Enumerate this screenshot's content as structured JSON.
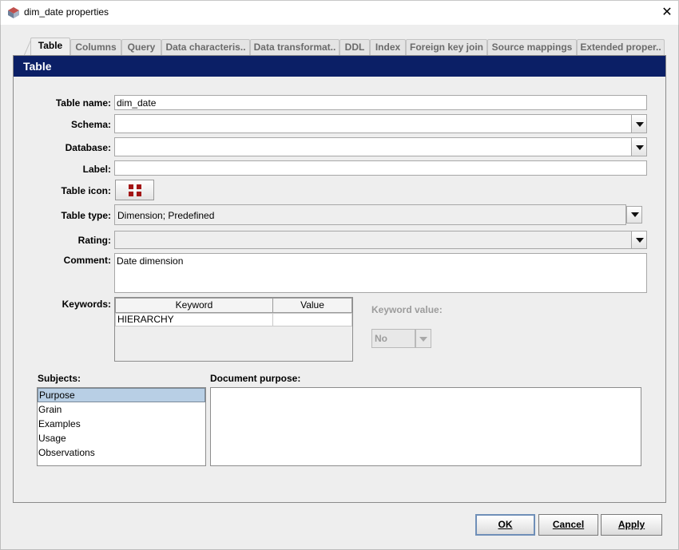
{
  "window": {
    "title": "dim_date properties",
    "app_icon": "app-logo-icon",
    "close_glyph": "✕"
  },
  "tabs": [
    {
      "label": "Table",
      "active": true
    },
    {
      "label": "Columns"
    },
    {
      "label": "Query"
    },
    {
      "label": "Data characteris.."
    },
    {
      "label": "Data transformat.."
    },
    {
      "label": "DDL"
    },
    {
      "label": "Index"
    },
    {
      "label": "Foreign key join"
    },
    {
      "label": "Source mappings"
    },
    {
      "label": "Extended proper.."
    }
  ],
  "panel": {
    "header": "Table"
  },
  "form": {
    "table_name": {
      "label": "Table name:",
      "value": "dim_date"
    },
    "schema": {
      "label": "Schema:",
      "value": ""
    },
    "database": {
      "label": "Database:",
      "value": ""
    },
    "label_field": {
      "label": "Label:",
      "value": ""
    },
    "table_icon": {
      "label": "Table icon:",
      "icon": "dimension-table-icon"
    },
    "table_type": {
      "label": "Table type:",
      "value": "Dimension; Predefined"
    },
    "rating": {
      "label": "Rating:",
      "value": ""
    },
    "comment": {
      "label": "Comment:",
      "value": "Date dimension"
    },
    "keywords": {
      "label": "Keywords:",
      "columns": [
        "Keyword",
        "Value"
      ],
      "rows": [
        [
          "HIERARCHY",
          ""
        ]
      ]
    },
    "keyword_value": {
      "label": "Keyword value:",
      "value": "No"
    }
  },
  "subjects": {
    "label": "Subjects:",
    "items": [
      "Purpose",
      "Grain",
      "Examples",
      "Usage",
      "Observations"
    ],
    "selected": "Purpose"
  },
  "document_purpose": {
    "label": "Document purpose:",
    "value": ""
  },
  "buttons": {
    "ok": "OK",
    "cancel": "Cancel",
    "apply": "Apply"
  },
  "colors": {
    "header_bg": "#0b1f66",
    "selection": "#b8cfe5",
    "icon_red": "#a31515"
  }
}
